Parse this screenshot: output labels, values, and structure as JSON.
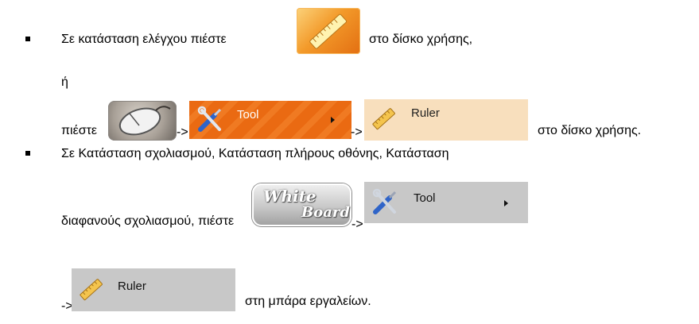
{
  "lines": {
    "l1_before": "Σε κατάσταση ελέγχου πιέστε",
    "l1_after": "στο δίσκο χρήσης,",
    "l2": "ή",
    "l3_before": "πιέστε",
    "arrow1": "->",
    "arrow2": "->",
    "l3_after": "στο δίσκο χρήσης.",
    "l4": "Σε Κατάσταση σχολιασμού, Κατάσταση πλήρους οθόνης, Κατάσταση",
    "l5_before": "διαφανούς σχολιασμού, πιέστε",
    "arrow3": "->",
    "arrow4": "->",
    "l6_after": "στη μπάρα εργαλείων."
  },
  "menus": {
    "tool_label": "Tool",
    "ruler_label": "Ruler",
    "whiteboard_line1": "White",
    "whiteboard_line2": "Board"
  },
  "icons": {
    "ruler": "ruler-icon",
    "mouse": "mouse-icon",
    "tools": "tools-icon",
    "submenu_arrow": "submenu-arrow-icon"
  },
  "colors": {
    "tool_orange": "#ea6a12",
    "ruler_peach": "#f8dfbd",
    "menu_grey": "#c8c8c8"
  }
}
